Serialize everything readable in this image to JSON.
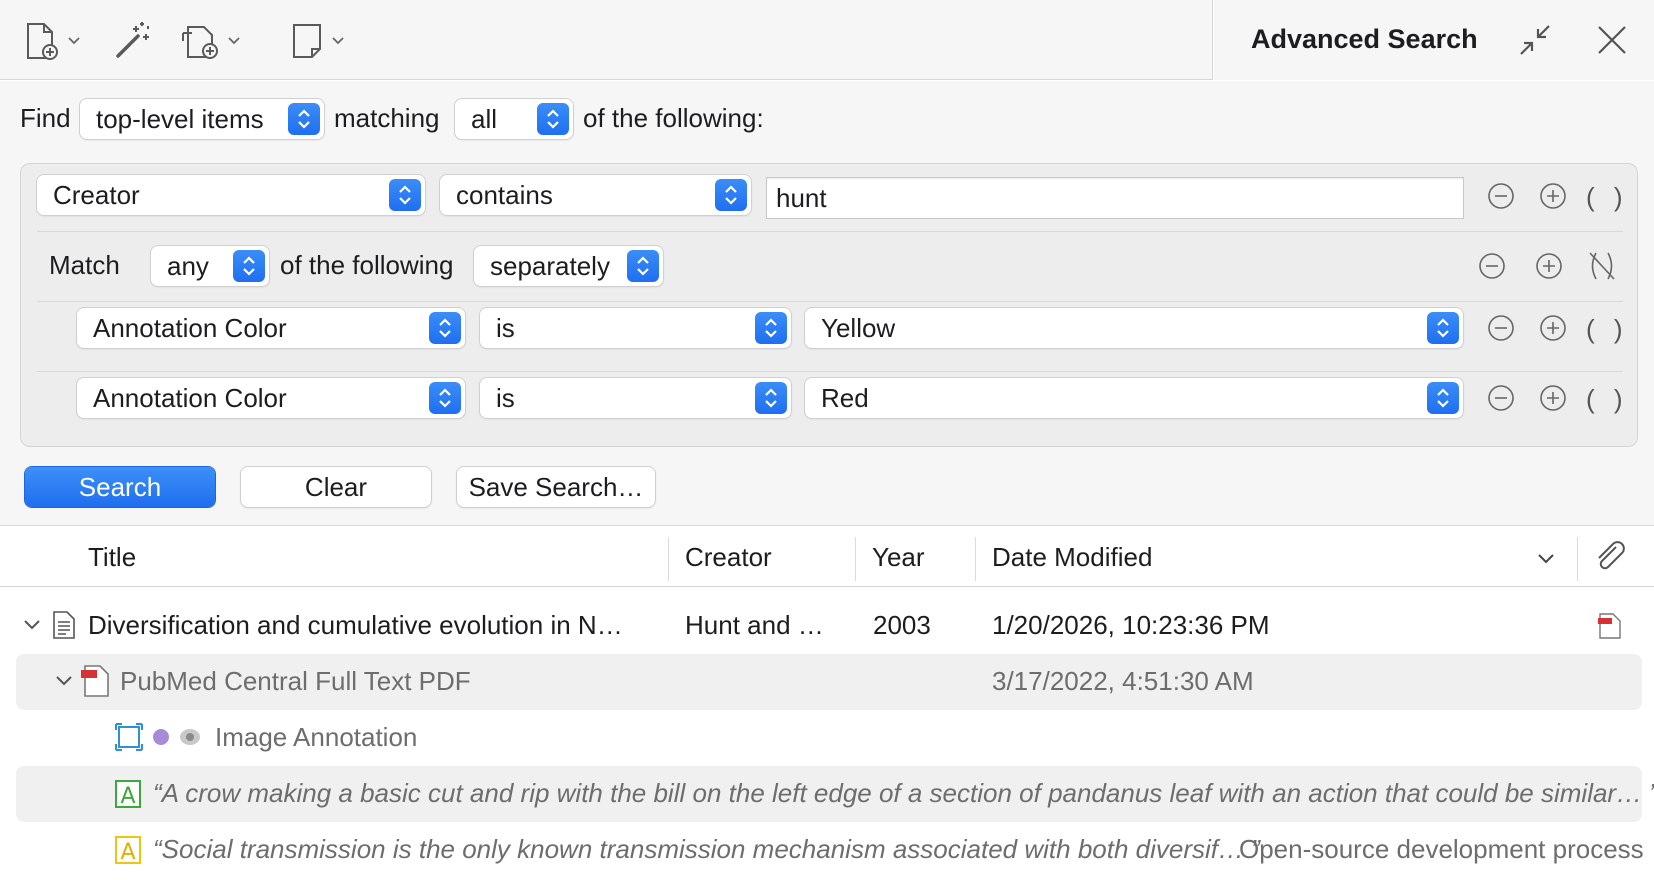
{
  "toolbar": {
    "new_item_icon": "new-item-icon",
    "magic_wand_icon": "magic-wand-icon",
    "add_attachment_icon": "add-attachment-icon",
    "new_note_icon": "new-note-icon"
  },
  "header": {
    "title": "Advanced Search"
  },
  "find": {
    "label_find": "Find",
    "scope_value": "top-level items",
    "label_matching": "matching",
    "match_value": "all",
    "label_following": "of the following:"
  },
  "conditions": {
    "row1": {
      "field": "Creator",
      "operator": "contains",
      "value": "hunt"
    },
    "group": {
      "label_match": "Match",
      "match_value": "any",
      "label_following": "of the following",
      "mode_value": "separately"
    },
    "row2": {
      "field": "Annotation Color",
      "operator": "is",
      "value": "Yellow"
    },
    "row3": {
      "field": "Annotation Color",
      "operator": "is",
      "value": "Red"
    },
    "paren_label": "( )"
  },
  "buttons": {
    "search": "Search",
    "clear": "Clear",
    "save_search": "Save Search…"
  },
  "table": {
    "columns": {
      "title": "Title",
      "creator": "Creator",
      "year": "Year",
      "date_modified": "Date Modified"
    },
    "rows": [
      {
        "title": "Diversification and cumulative evolution in N…",
        "creator": "Hunt and …",
        "year": "2003",
        "date_modified": "1/20/2026, 10:23:36 PM"
      },
      {
        "title": "PubMed Central Full Text PDF",
        "date_modified": "3/17/2022, 4:51:30 AM"
      },
      {
        "title": "Image Annotation"
      },
      {
        "title": "“A crow making a basic cut and rip with the bill on the left edge of a section of pandanus leaf with an action that could be similar… ”"
      },
      {
        "title": "“Social transmission is the only known transmission mechanism associated with both diversif… ”",
        "comment": "Open-source development process"
      }
    ]
  },
  "colors": {
    "accent": "#1f6eef",
    "yellow_annotation": "#f1c40f",
    "green_annotation": "#3aa83a",
    "purple_dot": "#a78bdb"
  }
}
